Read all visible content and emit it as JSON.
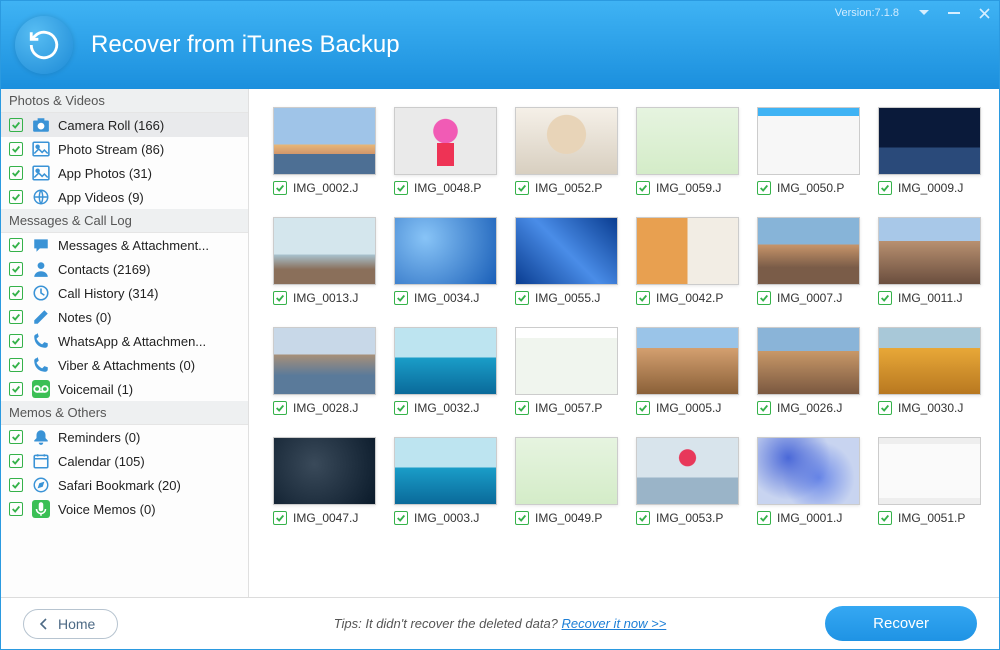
{
  "header": {
    "title": "Recover from iTunes Backup",
    "version": "Version:7.1.8"
  },
  "sidebar": {
    "groups": [
      {
        "title": "Photos & Videos",
        "items": [
          {
            "icon": "camera",
            "label": "Camera Roll (166)",
            "selected": true
          },
          {
            "icon": "photo",
            "label": "Photo Stream (86)"
          },
          {
            "icon": "photo",
            "label": "App Photos (31)"
          },
          {
            "icon": "globe",
            "label": "App Videos (9)"
          }
        ]
      },
      {
        "title": "Messages & Call Log",
        "items": [
          {
            "icon": "bubble",
            "label": "Messages & Attachment..."
          },
          {
            "icon": "person",
            "label": "Contacts (2169)"
          },
          {
            "icon": "clock",
            "label": "Call History (314)"
          },
          {
            "icon": "pencil",
            "label": "Notes (0)"
          },
          {
            "icon": "phone",
            "label": "WhatsApp & Attachmen..."
          },
          {
            "icon": "phone",
            "label": "Viber & Attachments (0)"
          },
          {
            "icon": "voicemail",
            "label": "Voicemail (1)",
            "iconStyle": "green"
          }
        ]
      },
      {
        "title": "Memos & Others",
        "items": [
          {
            "icon": "bell",
            "label": "Reminders (0)"
          },
          {
            "icon": "calendar",
            "label": "Calendar (105)"
          },
          {
            "icon": "compass",
            "label": "Safari Bookmark (20)"
          },
          {
            "icon": "mic",
            "label": "Voice Memos (0)",
            "iconStyle": "green"
          }
        ]
      }
    ]
  },
  "thumbnails": [
    {
      "name": "IMG_0002.J",
      "art": "t-sunset"
    },
    {
      "name": "IMG_0048.P",
      "art": "t-flower"
    },
    {
      "name": "IMG_0052.P",
      "art": "t-cat"
    },
    {
      "name": "IMG_0059.J",
      "art": "t-chat1"
    },
    {
      "name": "IMG_0050.P",
      "art": "t-chat2"
    },
    {
      "name": "IMG_0009.J",
      "art": "t-night"
    },
    {
      "name": "IMG_0013.J",
      "art": "t-pier"
    },
    {
      "name": "IMG_0034.J",
      "art": "t-blueabs"
    },
    {
      "name": "IMG_0055.J",
      "art": "t-blueabs2"
    },
    {
      "name": "IMG_0042.P",
      "art": "t-collage"
    },
    {
      "name": "IMG_0007.J",
      "art": "t-city"
    },
    {
      "name": "IMG_0011.J",
      "art": "t-city2"
    },
    {
      "name": "IMG_0028.J",
      "art": "t-river"
    },
    {
      "name": "IMG_0032.J",
      "art": "t-ocean"
    },
    {
      "name": "IMG_0057.P",
      "art": "t-chat3"
    },
    {
      "name": "IMG_0005.J",
      "art": "t-sq"
    },
    {
      "name": "IMG_0026.J",
      "art": "t-sq2"
    },
    {
      "name": "IMG_0030.J",
      "art": "t-autumn"
    },
    {
      "name": "IMG_0047.J",
      "art": "t-dark"
    },
    {
      "name": "IMG_0003.J",
      "art": "t-ocean"
    },
    {
      "name": "IMG_0049.P",
      "art": "t-chat1"
    },
    {
      "name": "IMG_0053.P",
      "art": "t-kid"
    },
    {
      "name": "IMG_0001.J",
      "art": "t-blflw"
    },
    {
      "name": "IMG_0051.P",
      "art": "t-settings"
    }
  ],
  "footer": {
    "home": "Home",
    "tips_prefix": "Tips: It didn't recover the deleted data? ",
    "tips_link": "Recover it now >>",
    "recover": "Recover"
  }
}
